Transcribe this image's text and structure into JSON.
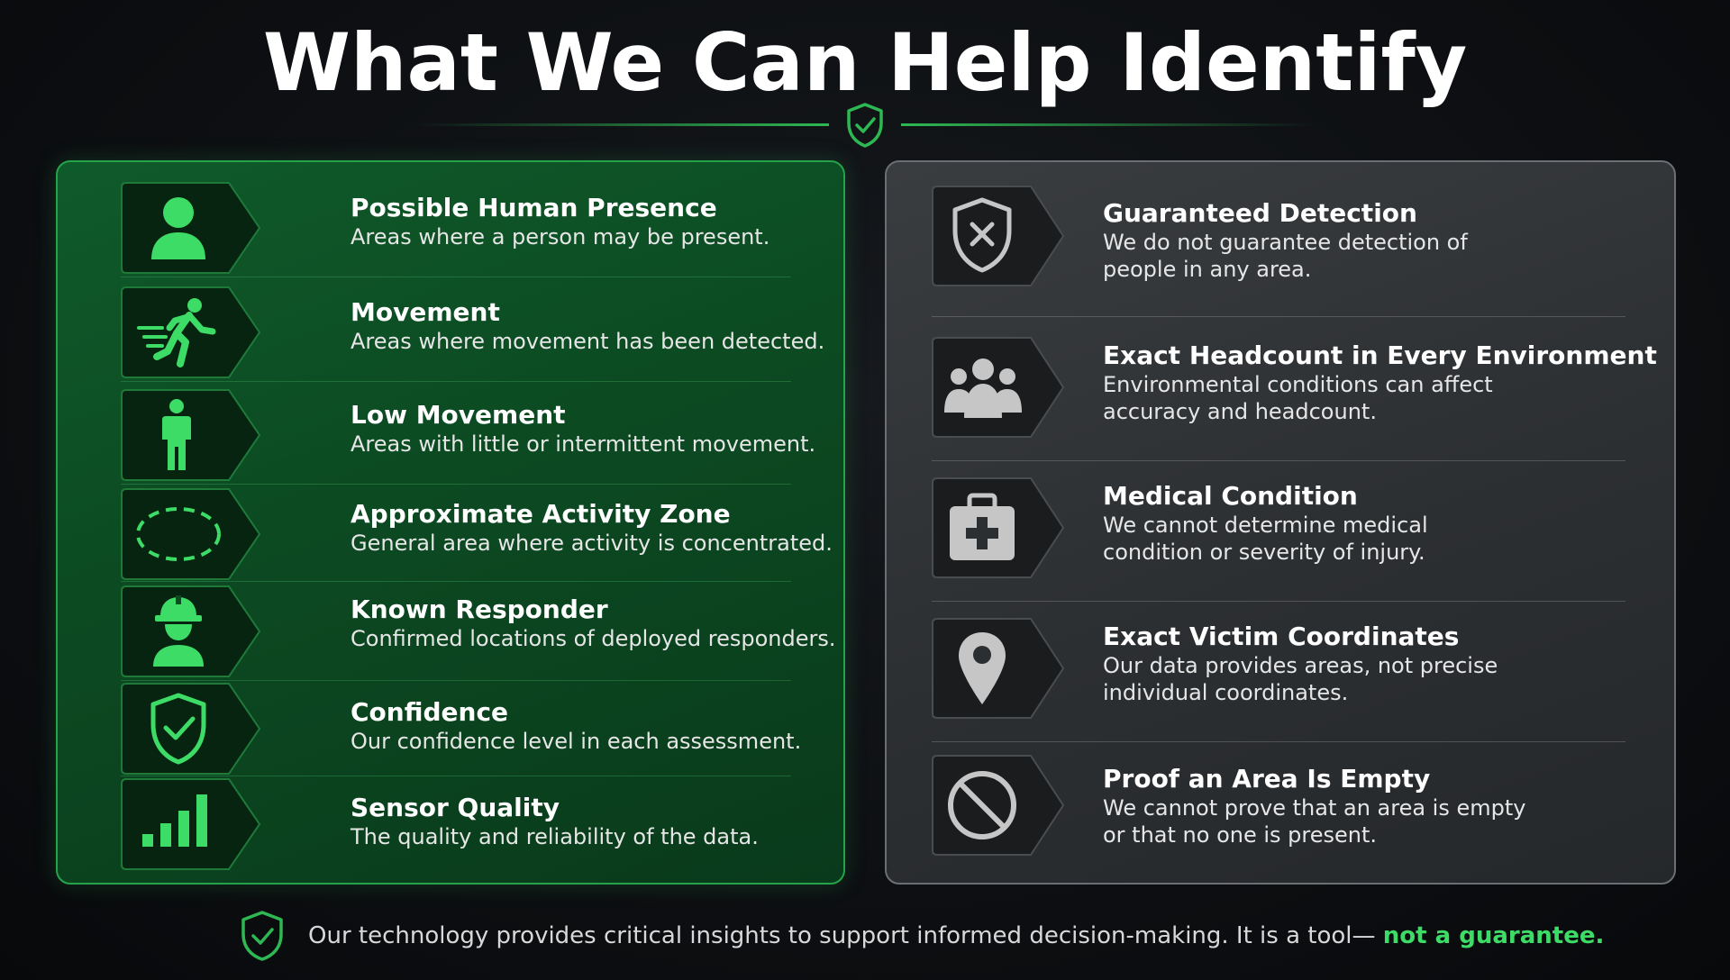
{
  "title": "What We Can Help Identify",
  "colors": {
    "accent_green": "#3ddc66",
    "panel_green": "#0c4a22",
    "panel_gray": "#2c2f32"
  },
  "can_identify": [
    {
      "icon": "person-icon",
      "title": "Possible Human Presence",
      "desc": "Areas where a person may be present."
    },
    {
      "icon": "running-person-icon",
      "title": "Movement",
      "desc": "Areas where movement has been detected."
    },
    {
      "icon": "standing-person-icon",
      "title": "Low Movement",
      "desc": "Areas with little or intermittent movement."
    },
    {
      "icon": "dashed-ellipse-icon",
      "title": "Approximate Activity Zone",
      "desc": "General area where activity is concentrated."
    },
    {
      "icon": "hard-hat-responder-icon",
      "title": "Known Responder",
      "desc": "Confirmed locations of deployed responders."
    },
    {
      "icon": "shield-check-icon",
      "title": "Confidence",
      "desc": "Our confidence level in each assessment."
    },
    {
      "icon": "signal-bars-icon",
      "title": "Sensor Quality",
      "desc": "The quality and reliability of the data."
    }
  ],
  "cannot_identify": [
    {
      "icon": "shield-x-icon",
      "title": "Guaranteed Detection",
      "desc": "We do not guarantee detection of people in any area."
    },
    {
      "icon": "group-people-icon",
      "title": "Exact Headcount in Every Environment",
      "desc": "Environmental conditions can affect accuracy and headcount."
    },
    {
      "icon": "medical-kit-icon",
      "title": "Medical Condition",
      "desc": "We cannot determine medical condition or severity of injury."
    },
    {
      "icon": "map-pin-icon",
      "title": "Exact Victim Coordinates",
      "desc": "Our data provides areas, not precise individual coordinates."
    },
    {
      "icon": "prohibited-icon",
      "title": "Proof an Area Is Empty",
      "desc": "We cannot prove that an area is empty or that no one is present."
    }
  ],
  "footer": {
    "text": "Our technology provides critical insights to support informed decision-making. It is a tool— ",
    "emphasis": "not a guarantee."
  }
}
